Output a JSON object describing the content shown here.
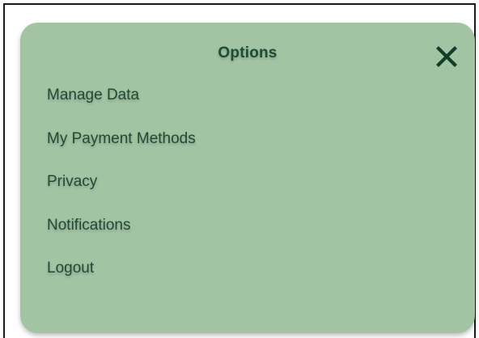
{
  "dialog": {
    "title": "Options",
    "close_icon": "close-icon",
    "menu_items": [
      {
        "label": "Manage Data"
      },
      {
        "label": "My Payment Methods"
      },
      {
        "label": "Privacy"
      },
      {
        "label": "Notifications"
      },
      {
        "label": "Logout"
      }
    ]
  },
  "colors": {
    "panel_background": "#a3c4a3",
    "text": "#1e4a36",
    "close_icon": "#123d2a"
  }
}
